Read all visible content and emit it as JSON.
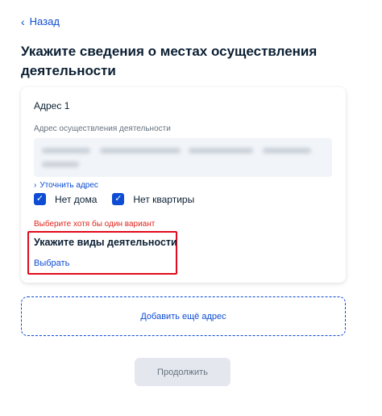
{
  "nav": {
    "back_label": "Назад"
  },
  "page": {
    "title": "Укажите сведения о местах осуществления деятельности"
  },
  "address_card": {
    "title": "Адрес 1",
    "address_field_label": "Адрес осуществления деятельности",
    "refine_link": "Уточнить адрес",
    "checkboxes": [
      {
        "label": "Нет дома",
        "checked": true
      },
      {
        "label": "Нет квартиры",
        "checked": true
      }
    ],
    "error": "Выберите хотя бы один вариант",
    "activity": {
      "title": "Укажите виды деятельности",
      "choose_link": "Выбрать"
    }
  },
  "add_address_label": "Добавить ещё адрес",
  "continue_label": "Продолжить",
  "colors": {
    "accent": "#0d4cd3",
    "error": "#e1251b",
    "highlight": "#e00b1c",
    "disabled_bg": "#e4e8ee"
  }
}
